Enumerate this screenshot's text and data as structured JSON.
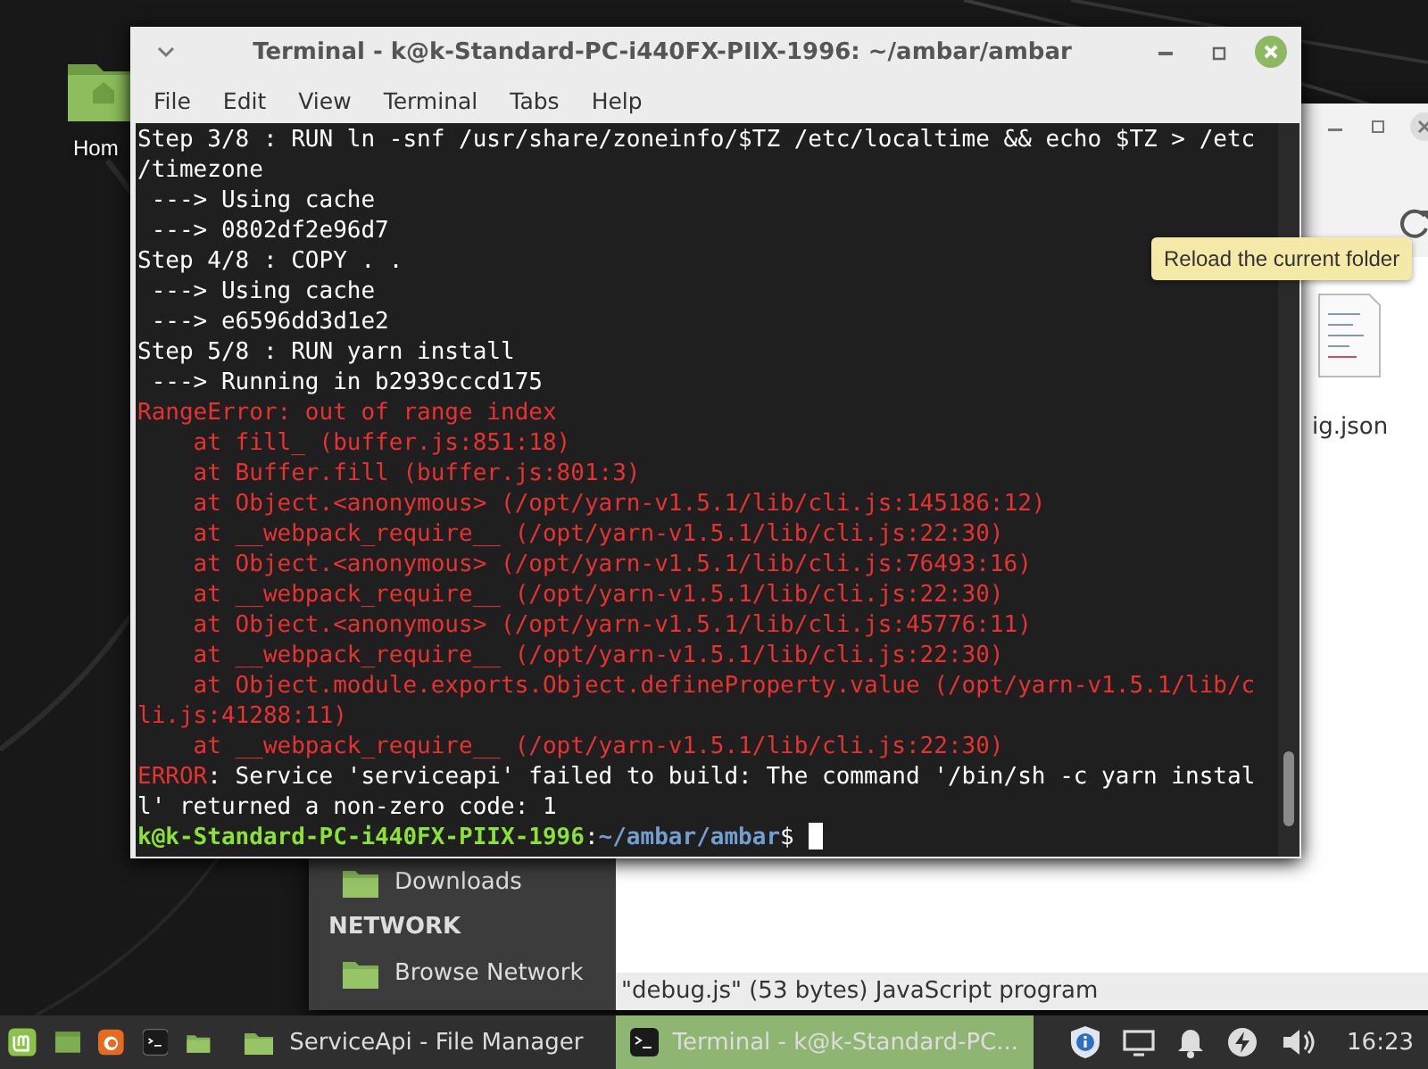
{
  "desktop": {
    "icons": [
      {
        "label": "Hom"
      }
    ]
  },
  "file_manager": {
    "items": [
      {
        "label": "ig.json"
      }
    ],
    "sidebar": [
      {
        "kind": "item",
        "label": "Downloads"
      },
      {
        "kind": "section",
        "label": "NETWORK"
      },
      {
        "kind": "item",
        "label": "Browse Network"
      }
    ],
    "status_bar": "\"debug.js\" (53 bytes) JavaScript program",
    "tooltip": "Reload the current folder"
  },
  "terminal": {
    "title": "Terminal - k@k-Standard-PC-i440FX-PIIX-1996: ~/ambar/ambar",
    "menu": [
      "File",
      "Edit",
      "View",
      "Terminal",
      "Tabs",
      "Help"
    ],
    "lines": [
      {
        "kind": "output",
        "text": "Step 3/8 : RUN ln -snf /usr/share/zoneinfo/$TZ /etc/localtime && echo $TZ > /etc"
      },
      {
        "kind": "output",
        "text": "/timezone"
      },
      {
        "kind": "output",
        "text": " ---> Using cache"
      },
      {
        "kind": "output",
        "text": " ---> 0802df2e96d7"
      },
      {
        "kind": "output",
        "text": "Step 4/8 : COPY . ."
      },
      {
        "kind": "output",
        "text": " ---> Using cache"
      },
      {
        "kind": "output",
        "text": " ---> e6596dd3d1e2"
      },
      {
        "kind": "output",
        "text": "Step 5/8 : RUN yarn install"
      },
      {
        "kind": "output",
        "text": " ---> Running in b2939cccd175"
      },
      {
        "kind": "error",
        "text": "RangeError: out of range index"
      },
      {
        "kind": "error",
        "text": "    at fill_ (buffer.js:851:18)"
      },
      {
        "kind": "error",
        "text": "    at Buffer.fill (buffer.js:801:3)"
      },
      {
        "kind": "error",
        "text": "    at Object.<anonymous> (/opt/yarn-v1.5.1/lib/cli.js:145186:12)"
      },
      {
        "kind": "error",
        "text": "    at __webpack_require__ (/opt/yarn-v1.5.1/lib/cli.js:22:30)"
      },
      {
        "kind": "error",
        "text": "    at Object.<anonymous> (/opt/yarn-v1.5.1/lib/cli.js:76493:16)"
      },
      {
        "kind": "error",
        "text": "    at __webpack_require__ (/opt/yarn-v1.5.1/lib/cli.js:22:30)"
      },
      {
        "kind": "error",
        "text": "    at Object.<anonymous> (/opt/yarn-v1.5.1/lib/cli.js:45776:11)"
      },
      {
        "kind": "error",
        "text": "    at __webpack_require__ (/opt/yarn-v1.5.1/lib/cli.js:22:30)"
      },
      {
        "kind": "error",
        "text": "    at Object.module.exports.Object.defineProperty.value (/opt/yarn-v1.5.1/lib/c"
      },
      {
        "kind": "error",
        "text": "li.js:41288:11)"
      },
      {
        "kind": "error",
        "text": "    at __webpack_require__ (/opt/yarn-v1.5.1/lib/cli.js:22:30)"
      },
      {
        "kind": "error_summary",
        "label": "ERROR",
        "text": ": Service 'serviceapi' failed to build: The command '/bin/sh -c yarn instal"
      },
      {
        "kind": "output",
        "text": "l' returned a non-zero code: 1"
      }
    ],
    "prompt": {
      "user_host": "k@k-Standard-PC-i440FX-PIIX-1996",
      "separator": ":",
      "path": "~/ambar/ambar",
      "sign": "$"
    }
  },
  "taskbar": {
    "tasks": [
      {
        "label": "ServiceApi - File Manager",
        "selected": false
      },
      {
        "label": "Terminal - k@k-Standard-PC...",
        "selected": true
      }
    ],
    "clock": "16:23"
  }
}
